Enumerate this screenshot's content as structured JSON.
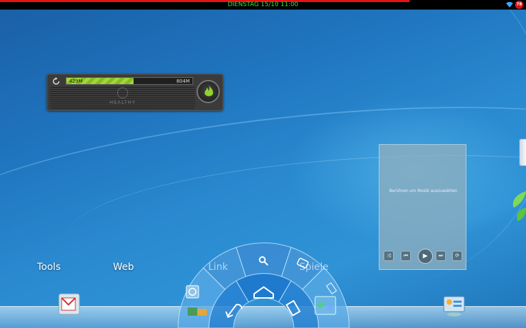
{
  "status_bar": {
    "datetime": "DIENSTAG 15/10 11:00",
    "battery": "78"
  },
  "memory_widget": {
    "used": "429M",
    "total": "804M",
    "used_fraction": 0.53,
    "health": "HEALTHY"
  },
  "music_widget": {
    "prompt": "Berühren um Musik auszuwählen"
  },
  "home_labels": {
    "tools": "Tools",
    "web": "Web"
  },
  "pie_menu": {
    "link": "Link",
    "games": "Spiele"
  },
  "colors": {
    "status_text": "#2ee62e",
    "status_progress": "#e41414",
    "memory_fill": "#a3d63a"
  }
}
